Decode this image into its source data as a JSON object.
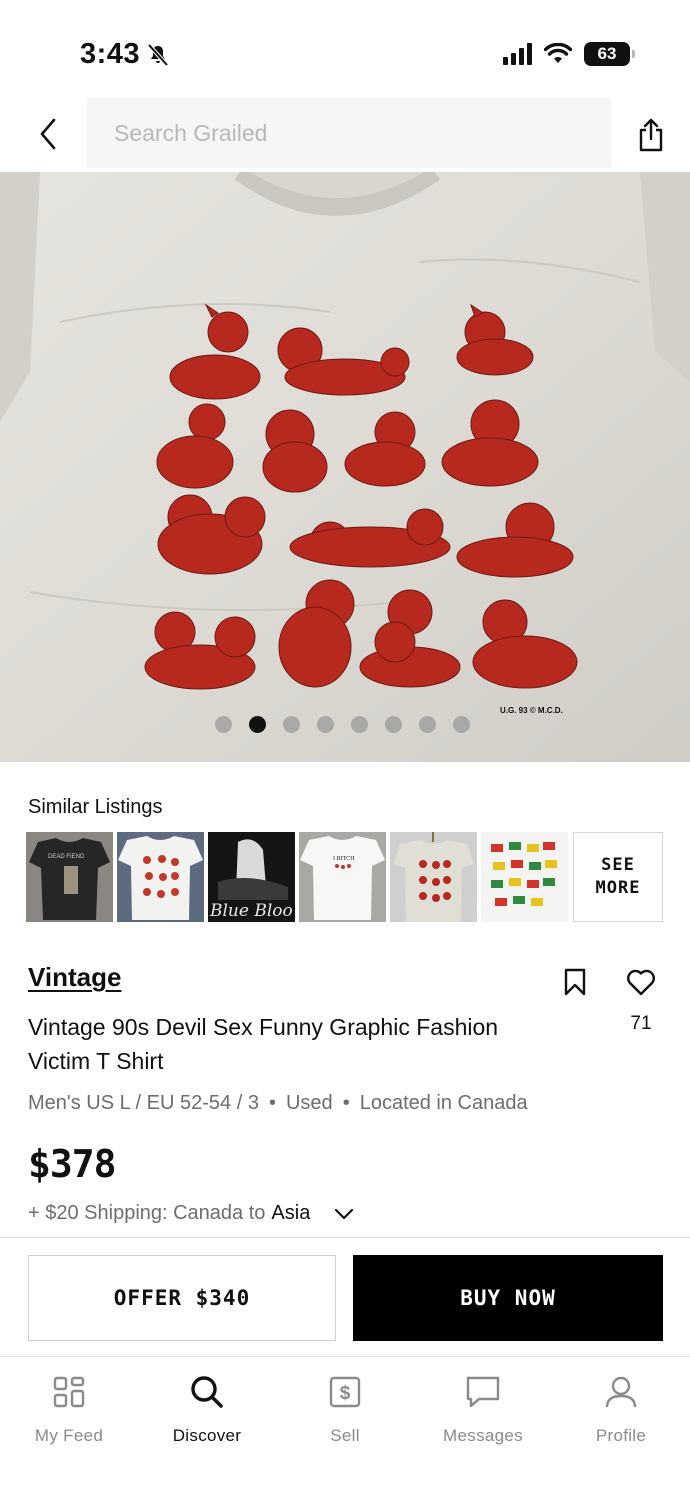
{
  "status_bar": {
    "time": "3:43",
    "battery": "63"
  },
  "search": {
    "placeholder": "Search Grailed"
  },
  "hero": {
    "image_count": 8,
    "active_index": 1,
    "print_mark": "U.G. 93 © M.C.D."
  },
  "similar": {
    "title": "Similar Listings",
    "thumb_texts": [
      "DEAD FIEND",
      "Blue Bloo",
      "I BITCH"
    ],
    "see_more": "SEE\nMORE"
  },
  "listing": {
    "designer": "Vintage",
    "title": "Vintage 90s Devil Sex Funny Graphic Fashion Victim T Shirt",
    "likes": "71",
    "size": "Men's US L / EU 52-54 / 3",
    "condition": "Used",
    "location": "Located in Canada",
    "price": "$378",
    "shipping_prefix": "+ $20 Shipping: Canada to",
    "shipping_dest": "Asia"
  },
  "actions": {
    "offer": "OFFER $340",
    "buy": "BUY NOW"
  },
  "tabs": [
    {
      "label": "My Feed",
      "icon": "grid-icon"
    },
    {
      "label": "Discover",
      "icon": "search-icon"
    },
    {
      "label": "Sell",
      "icon": "dollar-icon"
    },
    {
      "label": "Messages",
      "icon": "message-icon"
    },
    {
      "label": "Profile",
      "icon": "person-icon"
    }
  ],
  "colors": {
    "accent": "#000000",
    "print_red": "#b7291f",
    "shirt": "#dcdad3",
    "muted_text": "#6d6d6d"
  }
}
